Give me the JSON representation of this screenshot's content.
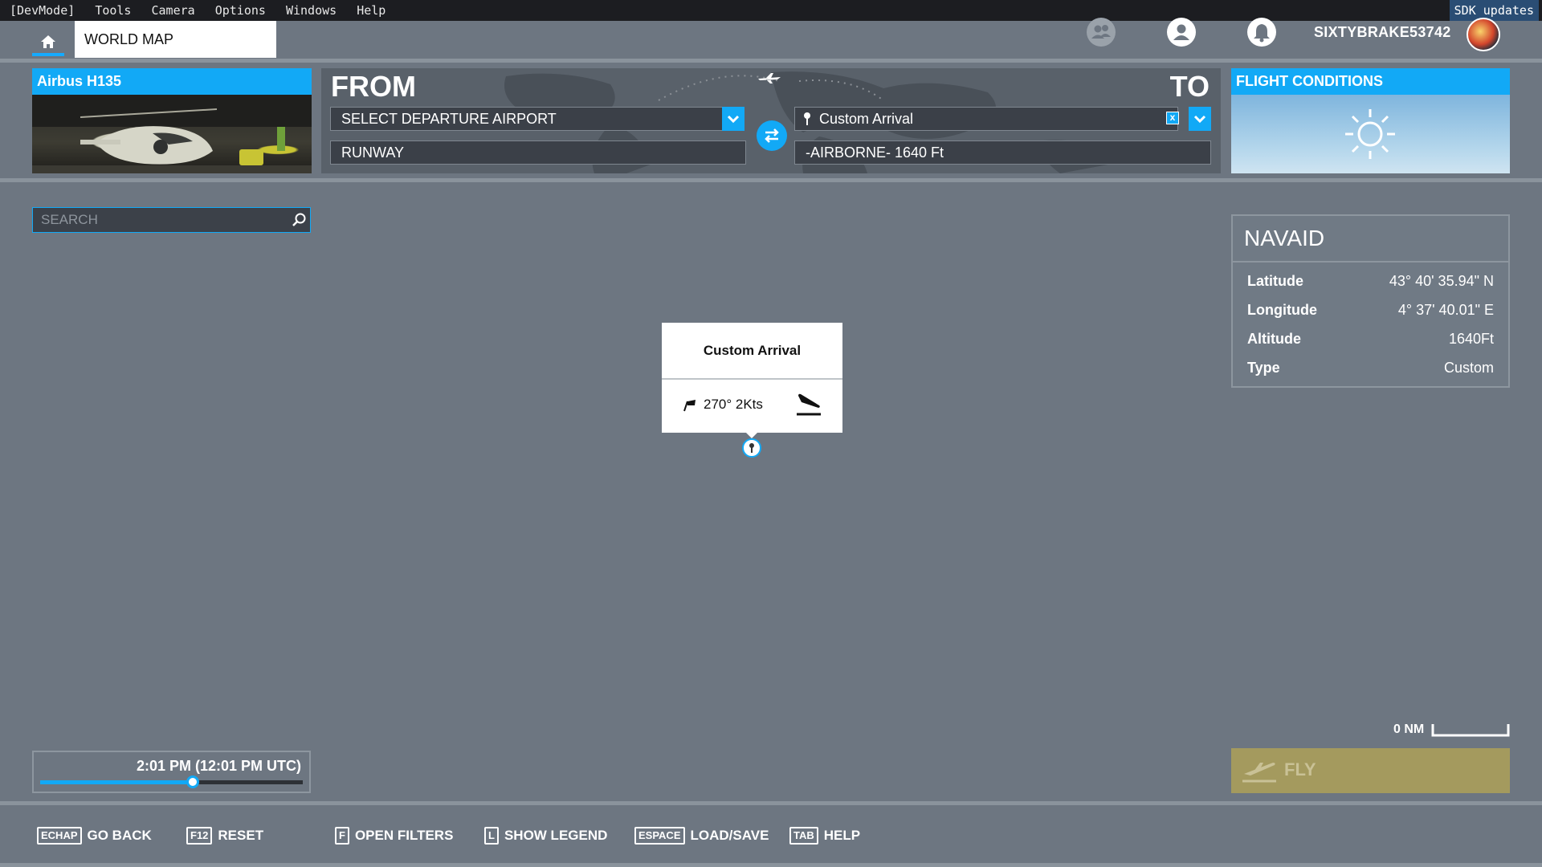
{
  "devbar": {
    "menu": [
      "[DevMode]",
      "Tools",
      "Camera",
      "Options",
      "Windows",
      "Help"
    ],
    "sdk": "SDK updates"
  },
  "header": {
    "home_icon": "home-icon",
    "world_map": "WORLD MAP",
    "username": "SIXTYBRAKE53742"
  },
  "aircraft": {
    "name": "Airbus H135"
  },
  "route": {
    "from_label": "FROM",
    "to_label": "TO",
    "departure": "SELECT DEPARTURE AIRPORT",
    "runway": "RUNWAY",
    "arrival": "Custom Arrival",
    "arrival_clear": "x",
    "airborne": "-AIRBORNE- 1640 Ft"
  },
  "flight_conditions": {
    "title": "FLIGHT CONDITIONS"
  },
  "search": {
    "placeholder": "SEARCH"
  },
  "navaid": {
    "title": "NAVAID",
    "rows": [
      {
        "key": "Latitude",
        "value": "43° 40' 35.94\" N"
      },
      {
        "key": "Longitude",
        "value": "4° 37' 40.01\" E"
      },
      {
        "key": "Altitude",
        "value": "1640Ft"
      },
      {
        "key": "Type",
        "value": "Custom"
      }
    ]
  },
  "popup": {
    "title": "Custom Arrival",
    "wind": "270° 2Kts"
  },
  "scale": {
    "label": "0 NM"
  },
  "time": {
    "label": "2:01 PM (12:01 PM UTC)",
    "progress": 0.58
  },
  "fly": {
    "label": "FLY"
  },
  "bottom": [
    {
      "key": "ECHAP",
      "label": "GO BACK"
    },
    {
      "key": "F12",
      "label": "RESET"
    },
    {
      "key": "F",
      "label": "OPEN FILTERS"
    },
    {
      "key": "L",
      "label": "SHOW LEGEND"
    },
    {
      "key": "ESPACE",
      "label": "LOAD/SAVE"
    },
    {
      "key": "TAB",
      "label": "HELP"
    }
  ],
  "colors": {
    "accent": "#12a9f6",
    "background": "#6d7681",
    "fly": "#a49a5e"
  }
}
